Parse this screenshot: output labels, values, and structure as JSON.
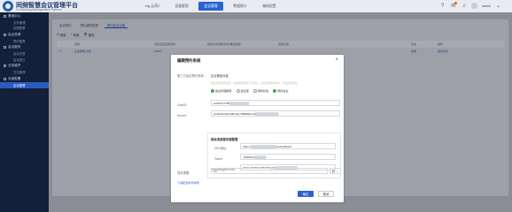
{
  "app": {
    "title": "同频智慧会议管理平台",
    "subtitle": "Co-Meeting Management Platform"
  },
  "topnav": [
    {
      "label": "org-云桥Z",
      "active": false
    },
    {
      "label": "设备管理",
      "active": false
    },
    {
      "label": "会议管理",
      "active": true
    },
    {
      "label": "数据统计",
      "active": false
    },
    {
      "label": "基础配置",
      "active": false
    }
  ],
  "user": {
    "name": "admin"
  },
  "sidebar": {
    "groups": [
      {
        "label": "基础中心",
        "items": [
          "文件管理",
          "权限配置"
        ]
      },
      {
        "label": "会议资源",
        "items": [
          "预约配置"
        ]
      },
      {
        "label": "会议服务",
        "items": [
          "会议列表",
          "会议统计"
        ]
      },
      {
        "label": "业务维护",
        "items": [
          "日志管理"
        ]
      },
      {
        "label": "对接配置",
        "items": [
          "会议配置"
        ]
      }
    ],
    "active_item": "会议配置"
  },
  "content": {
    "subtabs": [
      {
        "label": "会议预约",
        "active": false
      },
      {
        "label": "预约通知配置",
        "active": false
      },
      {
        "label": "预约会议对接",
        "active": true
      }
    ],
    "toolbar": {
      "refresh": "刷新",
      "add": "新增",
      "delete": "删除"
    },
    "table": {
      "columns": [
        "名称",
        "对接企业应用名称",
        "应用方式选择/同步/推送类型",
        "应用分类",
        "状态",
        "操作"
      ],
      "rows": [
        {
          "name": "企业微信-对接",
          "app": "ZOOK",
          "status": "启用",
          "actions": [
            "会议列表",
            "对接会议配置",
            "删除"
          ]
        }
      ]
    }
  },
  "modal": {
    "title": "编辑预约系统",
    "close": "×",
    "system_name_label": "第三方会议预约系统：",
    "system_name_value": "企业微信对接",
    "hint": "请在对接配置设置，请在配置管理门户调试，请先设置地址和IP，对应配置地址",
    "radios": [
      {
        "label": "会议管理服务",
        "checked": true
      },
      {
        "label": "会议室",
        "checked": false
      },
      {
        "label": "预约状态",
        "checked": false
      },
      {
        "label": "预约会议",
        "checked": true
      }
    ],
    "corpid_label": "CorpID：",
    "corpid_value": "ww3d471765",
    "secret_label": "Secret：",
    "secret_value": "yCQbGFSZfxN5kT2pY0B8DE4-3k",
    "subbox_title": "接收消息服务器配置",
    "url_label": "URL地址：",
    "url_value": "https://",
    "url_suffix": "/ww/callback",
    "token_label": "Token：",
    "token_value": "YjKMAkG",
    "aeskey_label": "EncodingAESKey：",
    "aeskey_value": "7hDGz3Kf6XpY5W3Rkg8",
    "sync_label": "同步周期：",
    "sync_value": "10",
    "sync_unit": "秒",
    "download_link": "下载配置操作说明",
    "ok": "确定",
    "cancel": "取消"
  }
}
